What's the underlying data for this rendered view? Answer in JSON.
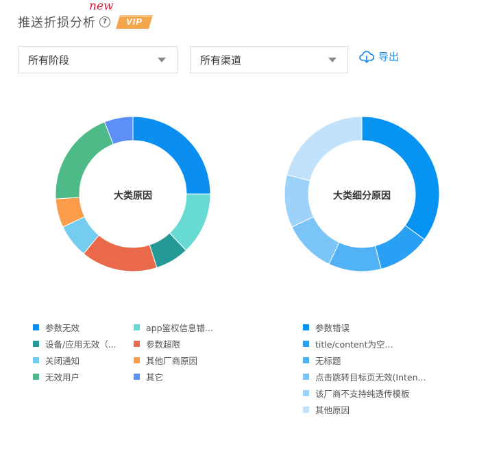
{
  "header": {
    "title": "推送折损分析",
    "help_icon": "question-circle-icon",
    "vip_label": "VIP",
    "new_label": "new"
  },
  "filters": {
    "stage_select": {
      "value": "所有阶段",
      "icon": "caret-down-icon"
    },
    "channel_select": {
      "value": "所有渠道",
      "icon": "caret-down-icon"
    },
    "export_label": "导出",
    "export_icon": "cloud-download-icon"
  },
  "chart_data": [
    {
      "type": "pie",
      "title": "大类原因",
      "categories": [
        "参数无效",
        "app鉴权信息错...",
        "设备/应用无效（...",
        "参数超限",
        "关闭通知",
        "其他厂商原因",
        "无效用户",
        "其它"
      ],
      "values": [
        25,
        13,
        7,
        16,
        7,
        6,
        20,
        6
      ],
      "colors": [
        "#0a8ff0",
        "#67dbd2",
        "#249998",
        "#ea694a",
        "#74ccee",
        "#fb9d4a",
        "#4eba88",
        "#5e8ff7"
      ]
    },
    {
      "type": "pie",
      "title": "大类细分原因",
      "categories": [
        "参数错误",
        "title/content为空...",
        "无标题",
        "点击跳转目标页无效(Inten...",
        "该厂商不支持纯透传模板",
        "其他原因"
      ],
      "values": [
        35,
        11,
        11,
        11,
        11,
        21
      ],
      "colors": [
        "#0793f2",
        "#2aa0f4",
        "#52b2f6",
        "#7ac4f8",
        "#9dd2fa",
        "#c2e2fb"
      ]
    }
  ]
}
